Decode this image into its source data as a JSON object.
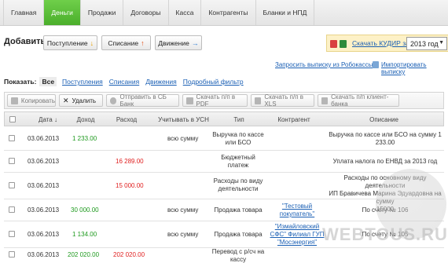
{
  "nav": {
    "tabs": [
      "Главная",
      "Деньги",
      "Продажи",
      "Договоры",
      "Касса",
      "Контрагенты",
      "Бланки и НПД"
    ],
    "active_index": 1
  },
  "add": {
    "title": "Добавить",
    "income_label": "Поступление",
    "writeoff_label": "Списание",
    "movement_label": "Движение",
    "kudir_link": "Скачать КУДИР за",
    "year_value": "2013 год"
  },
  "links": {
    "robokassa": "Запросить выписку из Робокассы",
    "import": "Импортировать выписку"
  },
  "filter": {
    "label": "Показать:",
    "all": "Все",
    "items": [
      "Поступления",
      "Списания",
      "Движения",
      "Подробный фильтр"
    ]
  },
  "toolbar": {
    "copy": "Копировать",
    "delete": "Удалить",
    "send_bank": "Отправить в СБ Банк",
    "download_pdf": "Скачать п/п в PDF",
    "download_xls": "Скачать п/п в XLS",
    "download_client": "Скачать п/п клиент-банка"
  },
  "table": {
    "headers": {
      "date": "Дата ↓",
      "income": "Доход",
      "expense": "Расход",
      "usn": "Учитывать в УСН",
      "type": "Тип",
      "counterparty": "Контрагент",
      "description": "Описание"
    },
    "rows": [
      {
        "date": "03.06.2013",
        "income": "1 233.00",
        "expense": "",
        "usn": "всю сумму",
        "type": [
          "Выручка по кассе",
          "или БСО"
        ],
        "counterparty": [],
        "description": [
          "Выручка по кассе или БСО на сумму 1",
          "233.00"
        ]
      },
      {
        "date": "03.06.2013",
        "income": "",
        "expense": "16 289.00",
        "usn": "",
        "type": [
          "Бюджетный",
          "платеж"
        ],
        "counterparty": [],
        "description": [
          "Уплата налога по ЕНВД за 2013 год"
        ]
      },
      {
        "date": "03.06.2013",
        "income": "",
        "expense": "15 000.00",
        "usn": "",
        "type": [
          "Расходы по виду",
          "деятельности"
        ],
        "counterparty": [],
        "description": [
          "Расходы по основному виду деятельности",
          "ИП Бравичева Марина Эдуардовна на сумму",
          "15000"
        ]
      },
      {
        "date": "03.06.2013",
        "income": "30 000.00",
        "expense": "",
        "usn": "всю сумму",
        "type": [
          "Продажа товара"
        ],
        "counterparty": [
          "\"Тестовый",
          "покупатель\""
        ],
        "description": [
          "По счету № 106"
        ]
      },
      {
        "date": "03.06.2013",
        "income": "1 134.00",
        "expense": "",
        "usn": "всю сумму",
        "type": [
          "Продажа товара"
        ],
        "counterparty": [
          "\"Измайловский",
          "СФС\" Филиал ГУП",
          "\"Мосэнергия\""
        ],
        "description": [
          "По счету № 105"
        ]
      },
      {
        "date": "03.06.2013",
        "income": "202 020.00",
        "expense": "202 020.00",
        "usn": "",
        "type": [
          "Перевод с р/сч на",
          "кассу"
        ],
        "counterparty": [],
        "description": []
      }
    ]
  },
  "watermark": "WEBTOUS.RU",
  "colors": {
    "active_tab": "#4aae2b",
    "income": "#1e9a1e",
    "expense": "#e02020",
    "link": "#1a5fb4",
    "kudir_bg": "#fdf1c7"
  }
}
